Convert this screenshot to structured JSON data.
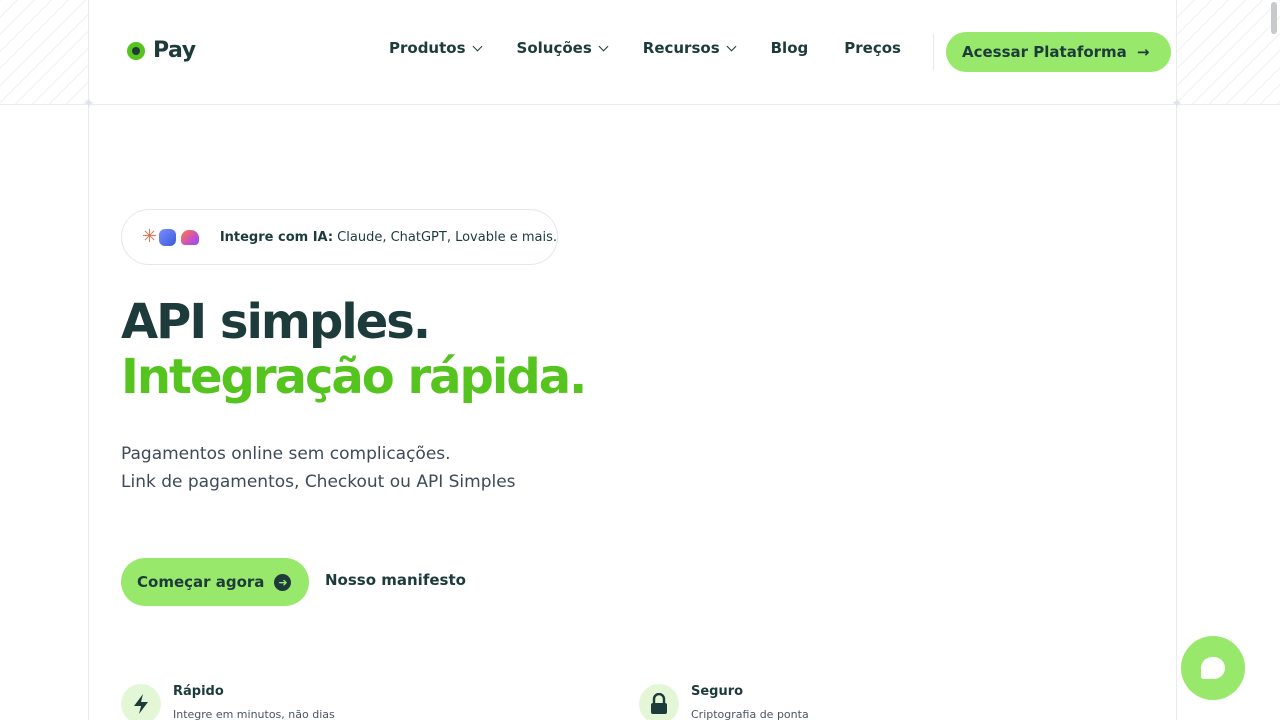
{
  "brand": {
    "name": "Pay"
  },
  "nav": {
    "items": [
      {
        "label": "Produtos",
        "dropdown": true
      },
      {
        "label": "Soluções",
        "dropdown": true
      },
      {
        "label": "Recursos",
        "dropdown": true
      },
      {
        "label": "Blog",
        "dropdown": false
      },
      {
        "label": "Preços",
        "dropdown": false
      }
    ],
    "cta_label": "Acessar Plataforma"
  },
  "badge": {
    "strong": "Integre com IA:",
    "text": " Claude, ChatGPT, Lovable e mais."
  },
  "hero": {
    "title_line1": "API simples.",
    "title_line2": "Integração rápida.",
    "subtitle_line1": "Pagamentos online sem complicações.",
    "subtitle_line2": "Link de pagamentos, Checkout ou API Simples",
    "primary_cta": "Começar agora",
    "secondary_cta": "Nosso manifesto"
  },
  "features": [
    {
      "title": "Rápido",
      "desc": "Integre em minutos, não dias",
      "icon": "bolt-icon"
    },
    {
      "title": "Seguro",
      "desc": "Criptografia de ponta",
      "icon": "lock-icon"
    }
  ],
  "colors": {
    "accent": "#98e86b",
    "brand_green": "#56c41e",
    "text_dark": "#1d3b3a"
  }
}
